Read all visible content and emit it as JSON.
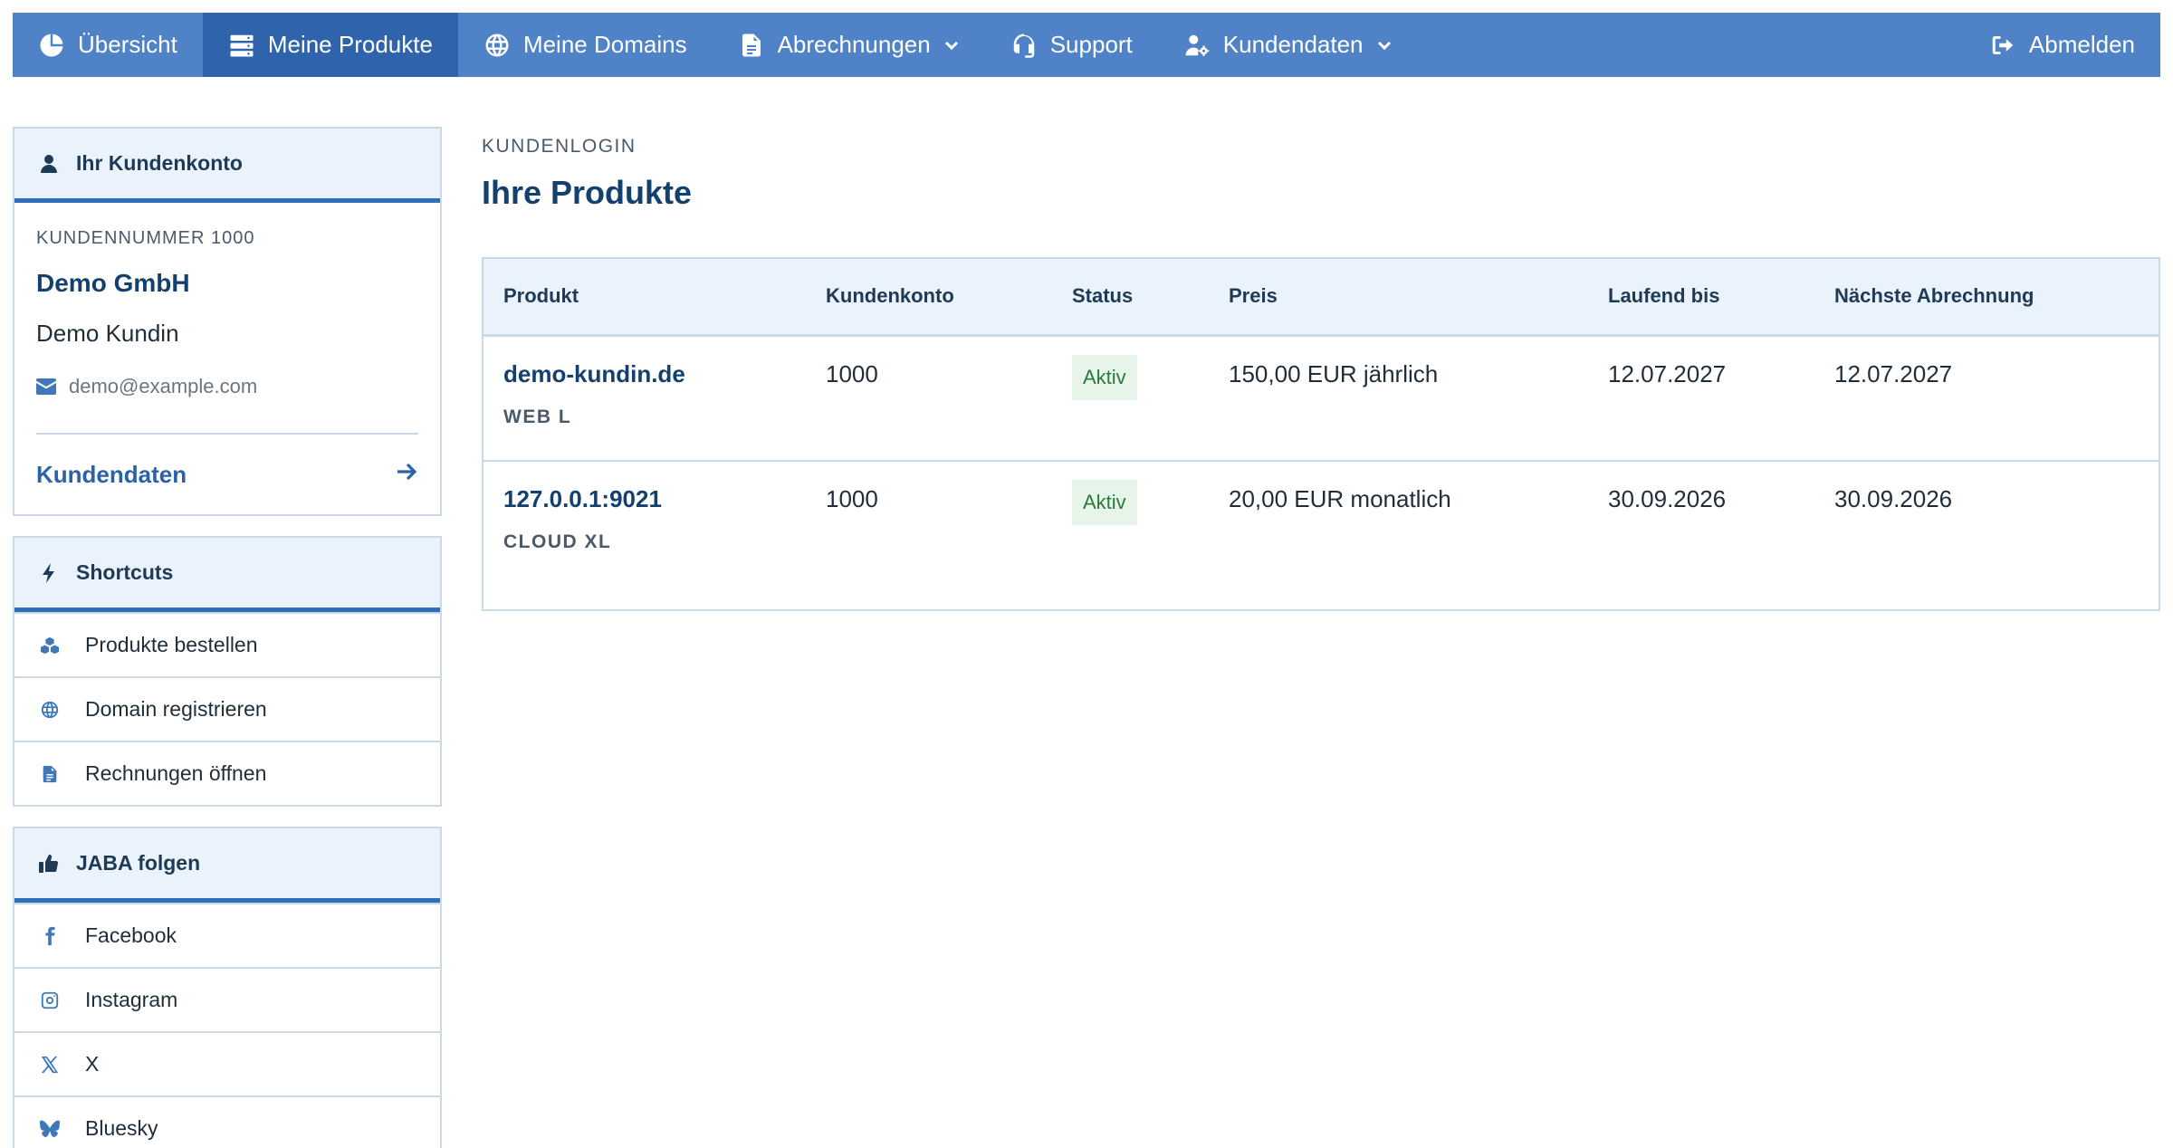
{
  "nav": {
    "items": [
      {
        "label": "Übersicht",
        "icon": "chart-pie-icon"
      },
      {
        "label": "Meine Produkte",
        "icon": "server-icon",
        "active": true
      },
      {
        "label": "Meine Domains",
        "icon": "globe-icon"
      },
      {
        "label": "Abrechnungen",
        "icon": "invoice-icon",
        "dropdown": true
      },
      {
        "label": "Support",
        "icon": "headset-icon"
      },
      {
        "label": "Kundendaten",
        "icon": "user-gear-icon",
        "dropdown": true
      }
    ],
    "logout_label": "Abmelden"
  },
  "account": {
    "header": "Ihr Kundenkonto",
    "number": "KUNDENNUMMER 1000",
    "company": "Demo GmbH",
    "name": "Demo Kundin",
    "email": "demo@example.com",
    "link_label": "Kundendaten"
  },
  "shortcuts": {
    "header": "Shortcuts",
    "items": [
      {
        "label": "Produkte bestellen",
        "icon": "cubes-icon"
      },
      {
        "label": "Domain registrieren",
        "icon": "globe-icon"
      },
      {
        "label": "Rechnungen öffnen",
        "icon": "invoice-icon"
      }
    ]
  },
  "social": {
    "header": "JABA folgen",
    "items": [
      {
        "label": "Facebook",
        "icon": "facebook-icon"
      },
      {
        "label": "Instagram",
        "icon": "instagram-icon"
      },
      {
        "label": "X",
        "icon": "x-icon"
      },
      {
        "label": "Bluesky",
        "icon": "bluesky-icon"
      }
    ]
  },
  "main": {
    "eyebrow": "KUNDENLOGIN",
    "title": "Ihre Produkte",
    "table": {
      "columns": [
        "Produkt",
        "Kundenkonto",
        "Status",
        "Preis",
        "Laufend bis",
        "Nächste Abrechnung"
      ],
      "rows": [
        {
          "product": "demo-kundin.de",
          "plan": "WEB L",
          "account": "1000",
          "status": "Aktiv",
          "price": "150,00 EUR jährlich",
          "running_until": "12.07.2027",
          "next_billing": "12.07.2027"
        },
        {
          "product": "127.0.0.1:9021",
          "plan": "CLOUD XL",
          "account": "1000",
          "status": "Aktiv",
          "price": "20,00 EUR monatlich",
          "running_until": "30.09.2026",
          "next_billing": "30.09.2026"
        }
      ]
    }
  },
  "colors": {
    "nav_bg": "#4f82c6",
    "nav_active": "#2f64ad",
    "accent": "#2f6fb6",
    "status_bg": "#e6f4e9",
    "status_text": "#2a7a3c"
  }
}
